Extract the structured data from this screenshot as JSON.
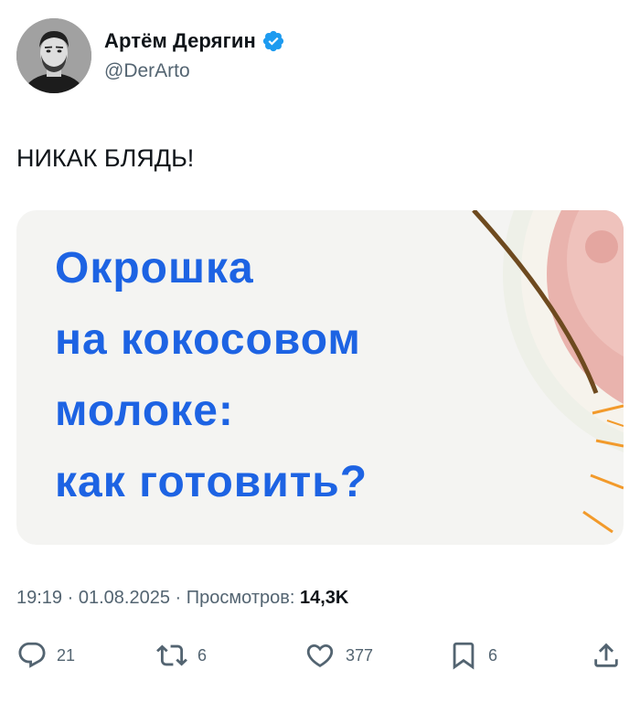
{
  "author": {
    "name": "Артём Дерягин",
    "handle": "@DerArto"
  },
  "tweet": {
    "text": "НИКАК БЛЯДЬ!"
  },
  "media": {
    "lines": [
      "Окрошка",
      "на кокосовом",
      "молоке:",
      "как готовить?"
    ]
  },
  "meta": {
    "time": "19:19",
    "separator": "·",
    "date": "01.08.2025",
    "views_label": "Просмотров:",
    "views_value": "14,3K"
  },
  "actions": {
    "replies": "21",
    "reposts": "6",
    "likes": "377",
    "bookmarks": "6"
  },
  "colors": {
    "headline_blue": "#1d63e3",
    "verified_blue": "#1d9bf0",
    "muted": "#536471"
  }
}
